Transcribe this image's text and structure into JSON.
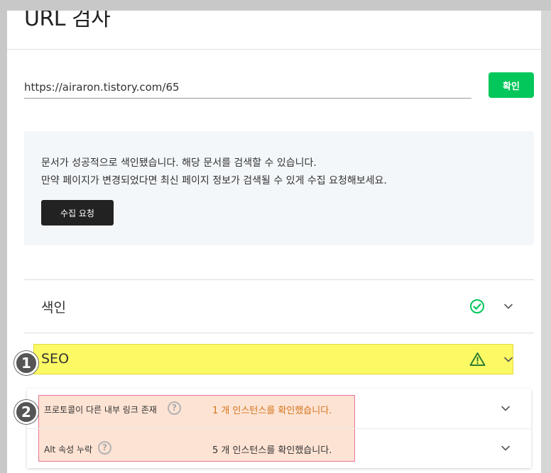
{
  "header": {
    "title": "URL 검사"
  },
  "url_form": {
    "url_value": "https://airaron.tistory.com/65",
    "confirm_label": "확인"
  },
  "info": {
    "line1": "문서가 성공적으로 색인됐습니다. 해당 문서를 검색할 수 있습니다.",
    "line2": "만약 페이지가 변경되었다면 최신 페이지 정보가 검색될 수 있게 수집 요청해보세요.",
    "crawl_button_label": "수집 요청"
  },
  "sections": [
    {
      "label": "색인",
      "status": "check-circle",
      "status_color": "#03c75a"
    },
    {
      "label": "SEO",
      "status": "warning-triangle",
      "status_color": "#2e7d32"
    }
  ],
  "seo_details": [
    {
      "label": "프로토콜이 다른 내부 링크 존재",
      "help": "?",
      "result": "1 개 인스턴스를 확인했습니다.",
      "result_color": "#d2741b"
    },
    {
      "label": "Alt 속성 누락",
      "help": "?",
      "result": "5 개 인스턴스를 확인했습니다.",
      "result_color": "#333333"
    }
  ],
  "markers": [
    "1",
    "2"
  ],
  "colors": {
    "accent_green": "#03c75a",
    "seo_highlight": "#fcfa64",
    "detail_highlight": "#fde3d4"
  }
}
